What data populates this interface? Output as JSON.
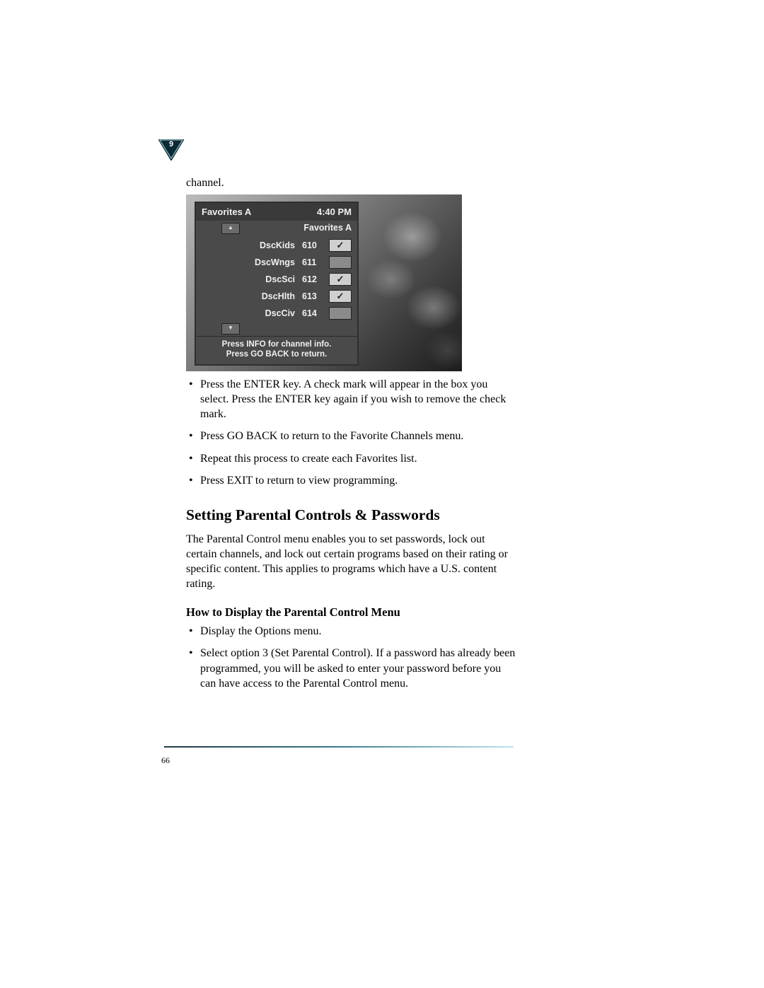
{
  "chapter": {
    "number": "9"
  },
  "leadText": "channel.",
  "screenshot": {
    "panel": {
      "title": "Favorites A",
      "time": "4:40 PM",
      "subtitle": "Favorites A",
      "channels": [
        {
          "name": "DscKids",
          "number": "610",
          "checked": true
        },
        {
          "name": "DscWngs",
          "number": "611",
          "checked": false
        },
        {
          "name": "DscSci",
          "number": "612",
          "checked": true
        },
        {
          "name": "DscHlth",
          "number": "613",
          "checked": true
        },
        {
          "name": "DscCiv",
          "number": "614",
          "checked": false
        }
      ],
      "hintLine1": "Press INFO for channel info.",
      "hintLine2": "Press GO BACK to return."
    }
  },
  "bullets1": [
    "Press the ENTER key. A check mark will appear in the box you select. Press the ENTER key again if you wish to remove the check mark.",
    "Press GO BACK to return to the Favorite Channels menu.",
    "Repeat this process to create each Favorites list.",
    "Press EXIT to return to view programming."
  ],
  "heading2": "Setting Parental Controls & Passwords",
  "paragraph": " The Parental Control menu enables you to set passwords, lock out certain channels, and lock out certain programs based on their rating or specific content. This applies to programs which have a U.S. content rating.",
  "heading3": "How to Display the Parental Control Menu",
  "bullets2": [
    "Display the Options menu.",
    "Select option 3 (Set Parental Control). If a password has already been programmed, you will be asked to enter your password before you can have access to the Parental Control menu."
  ],
  "pageNumber": "66"
}
